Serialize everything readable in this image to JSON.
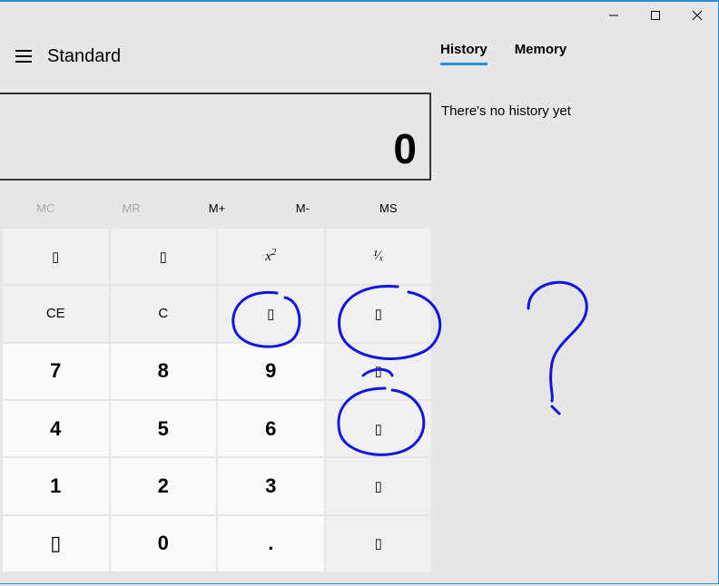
{
  "title": "Standard",
  "display_value": "0",
  "tabs": {
    "history": "History",
    "memory": "Memory"
  },
  "history_empty": "There's no history yet",
  "mem": {
    "mc": "MC",
    "mr": "MR",
    "mplus": "M+",
    "mminus": "M-",
    "ms": "MS"
  },
  "keys": {
    "percent": "▯",
    "sqrt": "▯",
    "sq": "x",
    "sq_exp": "2",
    "inv": "¹⁄ₓ",
    "ce": "CE",
    "c": "C",
    "back": "▯",
    "div": "▯",
    "k7": "7",
    "k8": "8",
    "k9": "9",
    "mul": "▯",
    "k4": "4",
    "k5": "5",
    "k6": "6",
    "sub": "▯",
    "k1": "1",
    "k2": "2",
    "k3": "3",
    "add": "▯",
    "neg": "▯",
    "k0": "0",
    "dot": ".",
    "eq": "▯"
  }
}
